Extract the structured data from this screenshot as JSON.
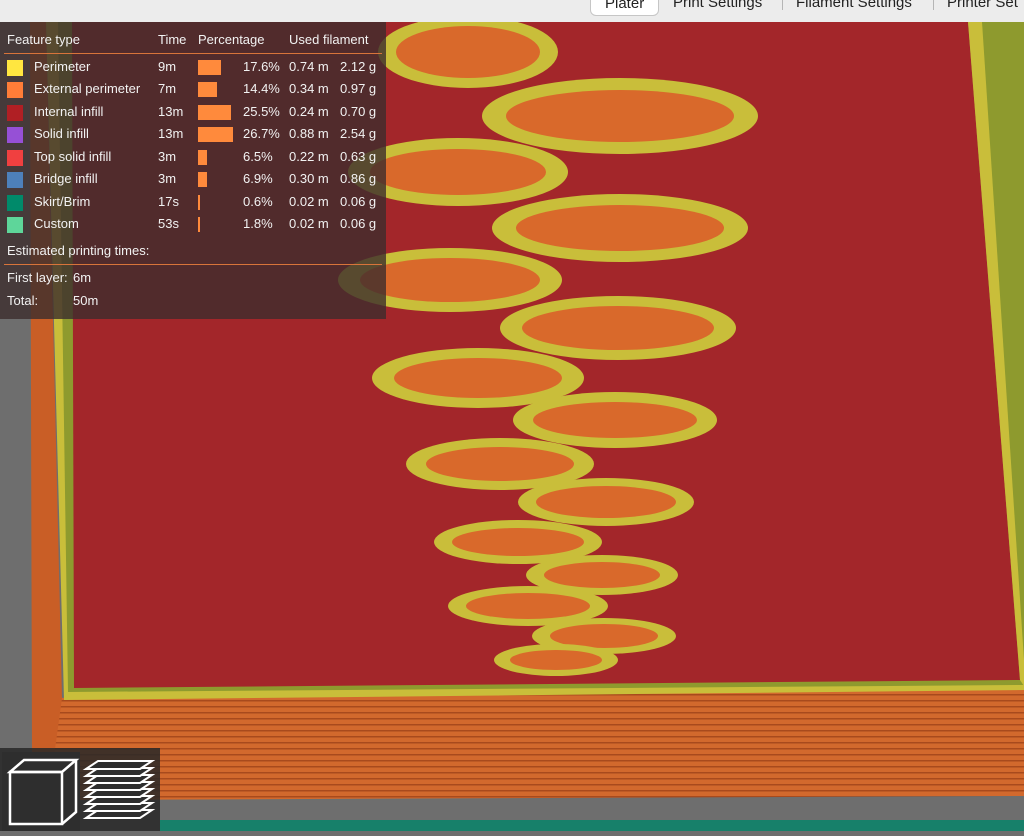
{
  "tabs": [
    {
      "label": "Plater",
      "active": true
    },
    {
      "label": "Print Settings",
      "active": false
    },
    {
      "label": "Filament Settings",
      "active": false
    },
    {
      "label": "Printer Set",
      "active": false
    }
  ],
  "legend": {
    "headers": {
      "feature": "Feature type",
      "time": "Time",
      "percentage": "Percentage",
      "filament": "Used filament"
    },
    "rows": [
      {
        "name": "Perimeter",
        "color": "#ffe640",
        "time": "9m",
        "pct": "17.6%",
        "pct_value": 17.6,
        "length": "0.74 m",
        "weight": "2.12 g"
      },
      {
        "name": "External perimeter",
        "color": "#ff7d38",
        "time": "7m",
        "pct": "14.4%",
        "pct_value": 14.4,
        "length": "0.34 m",
        "weight": "0.97 g"
      },
      {
        "name": "Internal infill",
        "color": "#b01f24",
        "time": "13m",
        "pct": "25.5%",
        "pct_value": 25.5,
        "length": "0.24 m",
        "weight": "0.70 g"
      },
      {
        "name": "Solid infill",
        "color": "#9650d6",
        "time": "13m",
        "pct": "26.7%",
        "pct_value": 26.7,
        "length": "0.88 m",
        "weight": "2.54 g"
      },
      {
        "name": "Top solid infill",
        "color": "#f04040",
        "time": "3m",
        "pct": "6.5%",
        "pct_value": 6.5,
        "length": "0.22 m",
        "weight": "0.63 g"
      },
      {
        "name": "Bridge infill",
        "color": "#4d80ba",
        "time": "3m",
        "pct": "6.9%",
        "pct_value": 6.9,
        "length": "0.30 m",
        "weight": "0.86 g"
      },
      {
        "name": "Skirt/Brim",
        "color": "#008a6a",
        "time": "17s",
        "pct": "0.6%",
        "pct_value": 0.6,
        "length": "0.02 m",
        "weight": "0.06 g"
      },
      {
        "name": "Custom",
        "color": "#5ed69a",
        "time": "53s",
        "pct": "1.8%",
        "pct_value": 1.8,
        "length": "0.02 m",
        "weight": "0.06 g"
      }
    ],
    "estimated_title": "Estimated printing times:",
    "first_layer_label": "First layer:",
    "first_layer_value": "6m",
    "total_label": "Total:",
    "total_value": "50m"
  },
  "view_buttons": [
    {
      "icon": "cube-view-icon",
      "selected": true
    },
    {
      "icon": "layers-view-icon",
      "selected": false
    }
  ],
  "colors": {
    "infill_red": "#a3262a",
    "perimeter_yellow": "#c9be3a",
    "external_orange": "#d9692b",
    "background": "#6e6e6e"
  }
}
